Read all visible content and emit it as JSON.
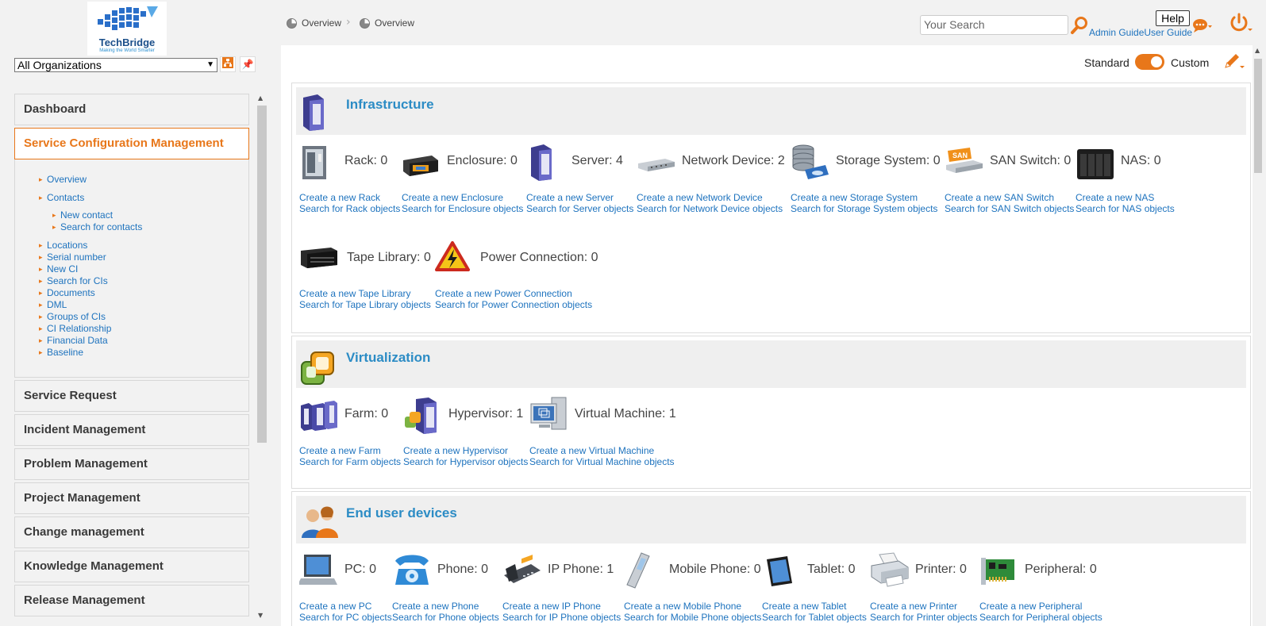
{
  "logo": {
    "brand": "TechBridge",
    "tagline": "Making the World Smarter"
  },
  "org_select": {
    "value": "All Organizations"
  },
  "sidebar": {
    "items": [
      {
        "label": "Dashboard"
      },
      {
        "label": "Service Configuration Management"
      },
      {
        "label": "Service Request"
      },
      {
        "label": "Incident Management"
      },
      {
        "label": "Problem Management"
      },
      {
        "label": "Project Management"
      },
      {
        "label": "Change management"
      },
      {
        "label": "Knowledge Management"
      },
      {
        "label": "Release Management"
      }
    ],
    "submenu": [
      "Overview",
      "Contacts",
      "New contact",
      "Search for contacts",
      "Locations",
      "Serial number",
      "New CI",
      "Search for CIs",
      "Documents",
      "DML",
      "Groups of CIs",
      "CI Relationship",
      "Financial Data",
      "Baseline"
    ]
  },
  "breadcrumb": {
    "first": "Overview",
    "second": "Overview"
  },
  "header": {
    "search_placeholder": "Your Search",
    "help": "Help",
    "admin_guide": "Admin Guide",
    "user_guide": "User Guide"
  },
  "view_mode": {
    "standard": "Standard",
    "custom": "Custom",
    "selected": "Custom"
  },
  "colors": {
    "accent": "#e8771a",
    "link": "#1e73be",
    "title": "#2c8cc5"
  },
  "sections": [
    {
      "title": "Infrastructure",
      "items": [
        {
          "count": "Rack: 0",
          "create": "Create a new Rack",
          "search": "Search for Rack objects",
          "icon": "rack-icon"
        },
        {
          "count": "Enclosure: 0",
          "create": "Create a new Enclosure",
          "search": "Search for Enclosure objects",
          "icon": "enclosure-icon"
        },
        {
          "count": "Server: 4",
          "create": "Create a new Server",
          "search": "Search for Server objects",
          "icon": "server-icon"
        },
        {
          "count": "Network Device: 2",
          "create": "Create a new Network Device",
          "search": "Search for Network Device objects",
          "icon": "network-device-icon"
        },
        {
          "count": "Storage System: 0",
          "create": "Create a new Storage System",
          "search": "Search for Storage System objects",
          "icon": "storage-system-icon"
        },
        {
          "count": "SAN Switch: 0",
          "create": "Create a new SAN Switch",
          "search": "Search for SAN Switch objects",
          "icon": "san-switch-icon",
          "badge": "SAN"
        },
        {
          "count": "NAS: 0",
          "create": "Create a new NAS",
          "search": "Search for NAS objects",
          "icon": "nas-icon"
        },
        {
          "count": "Tape Library: 0",
          "create": "Create a new Tape Library",
          "search": "Search for Tape Library objects",
          "icon": "tape-library-icon"
        },
        {
          "count": "Power Connection: 0",
          "create": "Create a new Power Connection",
          "search": "Search for Power Connection objects",
          "icon": "power-connection-icon"
        }
      ]
    },
    {
      "title": "Virtualization",
      "items": [
        {
          "count": "Farm: 0",
          "create": "Create a new Farm",
          "search": "Search for Farm objects",
          "icon": "farm-icon"
        },
        {
          "count": "Hypervisor: 1",
          "create": "Create a new Hypervisor",
          "search": "Search for Hypervisor objects",
          "icon": "hypervisor-icon"
        },
        {
          "count": "Virtual Machine: 1",
          "create": "Create a new Virtual Machine",
          "search": "Search for Virtual Machine objects",
          "icon": "virtual-machine-icon"
        }
      ]
    },
    {
      "title": "End user devices",
      "items": [
        {
          "count": "PC: 0",
          "create": "Create a new PC",
          "search": "Search for PC objects",
          "icon": "pc-icon"
        },
        {
          "count": "Phone: 0",
          "create": "Create a new Phone",
          "search": "Search for Phone objects",
          "icon": "phone-icon"
        },
        {
          "count": "IP Phone: 1",
          "create": "Create a new IP Phone",
          "search": "Search for IP Phone objects",
          "icon": "ip-phone-icon"
        },
        {
          "count": "Mobile Phone: 0",
          "create": "Create a new Mobile Phone",
          "search": "Search for Mobile Phone objects",
          "icon": "mobile-phone-icon"
        },
        {
          "count": "Tablet: 0",
          "create": "Create a new Tablet",
          "search": "Search for Tablet objects",
          "icon": "tablet-icon"
        },
        {
          "count": "Printer: 0",
          "create": "Create a new Printer",
          "search": "Search for Printer objects",
          "icon": "printer-icon"
        },
        {
          "count": "Peripheral: 0",
          "create": "Create a new Peripheral",
          "search": "Search for Peripheral objects",
          "icon": "peripheral-icon"
        }
      ]
    }
  ]
}
